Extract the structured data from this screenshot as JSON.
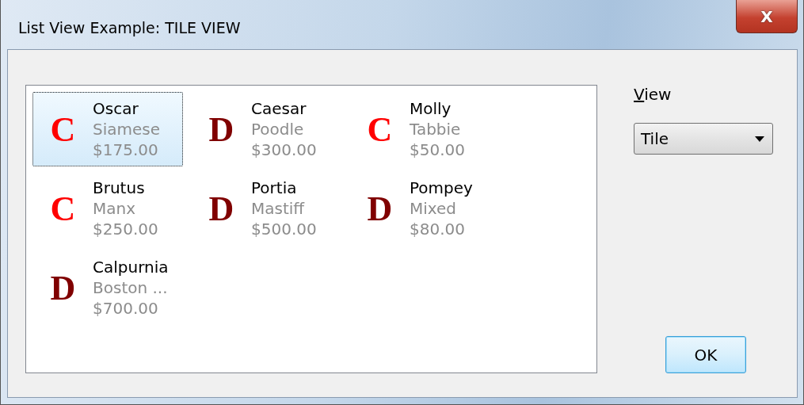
{
  "window": {
    "title": "List View Example: TILE VIEW",
    "close_label": "X"
  },
  "items": [
    {
      "icon": "C",
      "color": "#ff0000",
      "name": "Oscar",
      "breed": "Siamese",
      "price": "$175.00",
      "selected": true
    },
    {
      "icon": "D",
      "color": "#800000",
      "name": "Caesar",
      "breed": "Poodle",
      "price": "$300.00",
      "selected": false
    },
    {
      "icon": "C",
      "color": "#ff0000",
      "name": "Molly",
      "breed": "Tabbie",
      "price": "$50.00",
      "selected": false
    },
    {
      "icon": "C",
      "color": "#ff0000",
      "name": "Brutus",
      "breed": "Manx",
      "price": "$250.00",
      "selected": false
    },
    {
      "icon": "D",
      "color": "#800000",
      "name": "Portia",
      "breed": "Mastiff",
      "price": "$500.00",
      "selected": false
    },
    {
      "icon": "D",
      "color": "#800000",
      "name": "Pompey",
      "breed": "Mixed",
      "price": "$80.00",
      "selected": false
    },
    {
      "icon": "D",
      "color": "#800000",
      "name": "Calpurnia",
      "breed": "Boston ...",
      "price": "$700.00",
      "selected": false
    }
  ],
  "view": {
    "label": "View",
    "underline_first": true,
    "value": "Tile"
  },
  "buttons": [
    "OK"
  ]
}
